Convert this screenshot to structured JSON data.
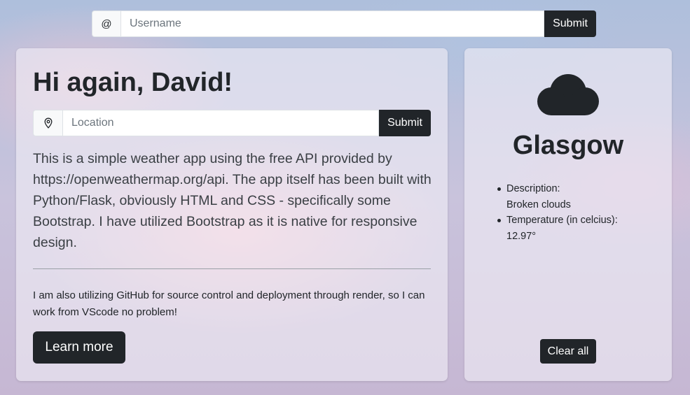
{
  "user_form": {
    "addon_symbol": "@",
    "placeholder": "Username",
    "submit_label": "Submit"
  },
  "main_card": {
    "greeting": "Hi again, David!",
    "location_form": {
      "icon": "map-pin-icon",
      "placeholder": "Location",
      "submit_label": "Submit"
    },
    "lead": "This is a simple weather app using the free API provided by https://openweathermap.org/api. The app itself has been built with Python/Flask, obviously HTML and CSS - specifically some Bootstrap. I have utilized Bootstrap as it is native for responsive design.",
    "note": "I am also utilizing GitHub for source control and deployment through render, so I can work from VScode no problem!",
    "learn_more_label": "Learn more"
  },
  "weather_card": {
    "icon": "cloud-icon",
    "city": "Glasgow",
    "description_label": "Description:",
    "description_value": "Broken clouds",
    "temperature_label": "Temperature (in celcius):",
    "temperature_value": "12.97°",
    "clear_label": "Clear all"
  },
  "colors": {
    "button_dark": "#212529",
    "text": "#212529"
  }
}
